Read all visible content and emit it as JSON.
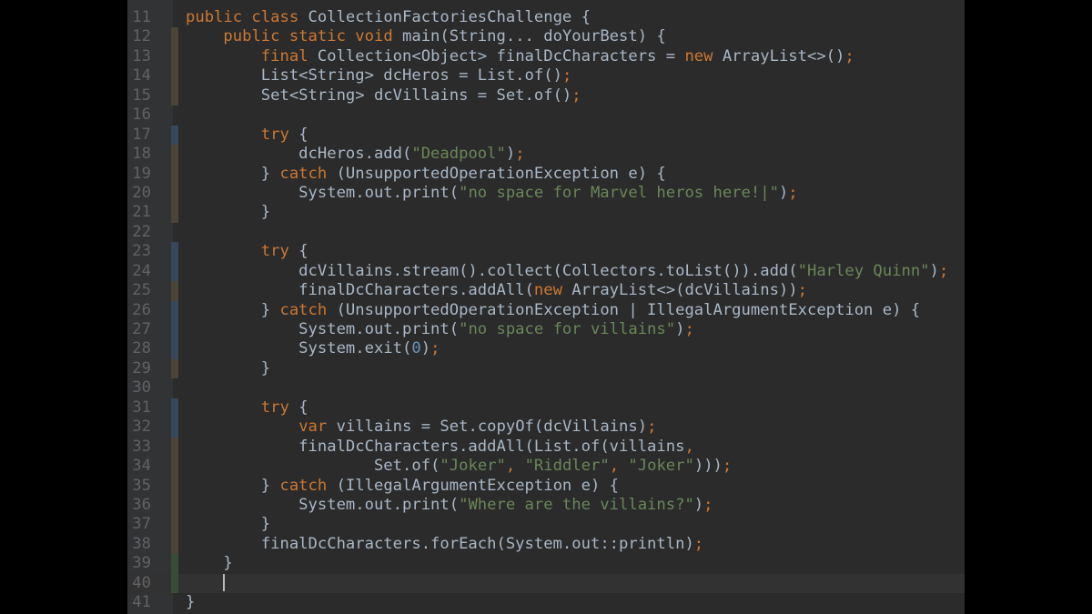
{
  "colors": {
    "background": "#2b2b2b",
    "gutter": "#313335",
    "keyword": "#cc7832",
    "string": "#6a8759",
    "number": "#6897bb",
    "text": "#a9b7c6",
    "line_number": "#606366"
  },
  "editor": {
    "current_line": 40,
    "lines": [
      {
        "n": "11",
        "mark": "",
        "tokens": [
          [
            "kw",
            "public class "
          ],
          [
            "t",
            "CollectionFactoriesChallenge {"
          ]
        ]
      },
      {
        "n": "12",
        "mark": "mod",
        "tokens": [
          [
            "t",
            "    "
          ],
          [
            "kw",
            "public static void "
          ],
          [
            "t",
            "main(String... doYourBest) {"
          ]
        ]
      },
      {
        "n": "13",
        "mark": "mod",
        "tokens": [
          [
            "t",
            "        "
          ],
          [
            "kw",
            "final "
          ],
          [
            "t",
            "Collection<Object> finalDcCharacters = "
          ],
          [
            "kw",
            "new "
          ],
          [
            "t",
            "ArrayList<>()"
          ],
          [
            "kw",
            ";"
          ]
        ]
      },
      {
        "n": "14",
        "mark": "mod",
        "tokens": [
          [
            "t",
            "        List<String> dcHeros = List."
          ],
          [
            "t",
            "of()"
          ],
          [
            "kw",
            ";"
          ]
        ]
      },
      {
        "n": "15",
        "mark": "mod",
        "tokens": [
          [
            "t",
            "        Set<String> dcVillains = Set."
          ],
          [
            "t",
            "of()"
          ],
          [
            "kw",
            ";"
          ]
        ]
      },
      {
        "n": "16",
        "mark": "",
        "tokens": []
      },
      {
        "n": "17",
        "mark": "blue",
        "tokens": [
          [
            "t",
            "        "
          ],
          [
            "kw",
            "try "
          ],
          [
            "t",
            "{"
          ]
        ]
      },
      {
        "n": "18",
        "mark": "mod",
        "tokens": [
          [
            "t",
            "            dcHeros.add("
          ],
          [
            "str",
            "\"Deadpool\""
          ],
          [
            "t",
            ")"
          ],
          [
            "kw",
            ";"
          ]
        ]
      },
      {
        "n": "19",
        "mark": "mod",
        "tokens": [
          [
            "t",
            "        } "
          ],
          [
            "kw",
            "catch "
          ],
          [
            "t",
            "(UnsupportedOperationException e) {"
          ]
        ]
      },
      {
        "n": "20",
        "mark": "mod",
        "tokens": [
          [
            "t",
            "            System."
          ],
          [
            "t",
            "out"
          ],
          [
            "t",
            ".print("
          ],
          [
            "str",
            "\"no space for Marvel heros here!|\""
          ],
          [
            "t",
            ")"
          ],
          [
            "kw",
            ";"
          ]
        ]
      },
      {
        "n": "21",
        "mark": "mod",
        "tokens": [
          [
            "t",
            "        }"
          ]
        ]
      },
      {
        "n": "22",
        "mark": "",
        "tokens": []
      },
      {
        "n": "23",
        "mark": "blue",
        "tokens": [
          [
            "t",
            "        "
          ],
          [
            "kw",
            "try "
          ],
          [
            "t",
            "{"
          ]
        ]
      },
      {
        "n": "24",
        "mark": "blue",
        "tokens": [
          [
            "t",
            "            dcVillains.stream().collect(Collectors."
          ],
          [
            "t",
            "toList"
          ],
          [
            "t",
            "()).add("
          ],
          [
            "str",
            "\"Harley Quinn\""
          ],
          [
            "t",
            ")"
          ],
          [
            "kw",
            ";"
          ]
        ]
      },
      {
        "n": "25",
        "mark": "mod",
        "tokens": [
          [
            "t",
            "            finalDcCharacters.addAll("
          ],
          [
            "kw",
            "new "
          ],
          [
            "t",
            "ArrayList<>(dcVillains))"
          ],
          [
            "kw",
            ";"
          ]
        ]
      },
      {
        "n": "26",
        "mark": "blue",
        "tokens": [
          [
            "t",
            "        } "
          ],
          [
            "kw",
            "catch "
          ],
          [
            "t",
            "(UnsupportedOperationException | IllegalArgumentException e) {"
          ]
        ]
      },
      {
        "n": "27",
        "mark": "blue",
        "tokens": [
          [
            "t",
            "            System."
          ],
          [
            "t",
            "out"
          ],
          [
            "t",
            ".print("
          ],
          [
            "str",
            "\"no space for villains\""
          ],
          [
            "t",
            ")"
          ],
          [
            "kw",
            ";"
          ]
        ]
      },
      {
        "n": "28",
        "mark": "blue",
        "tokens": [
          [
            "t",
            "            System."
          ],
          [
            "t",
            "exit"
          ],
          [
            "t",
            "("
          ],
          [
            "num",
            "0"
          ],
          [
            "t",
            ")"
          ],
          [
            "kw",
            ";"
          ]
        ]
      },
      {
        "n": "29",
        "mark": "mod",
        "tokens": [
          [
            "t",
            "        }"
          ]
        ]
      },
      {
        "n": "30",
        "mark": "",
        "tokens": []
      },
      {
        "n": "31",
        "mark": "blue",
        "tokens": [
          [
            "t",
            "        "
          ],
          [
            "kw",
            "try "
          ],
          [
            "t",
            "{"
          ]
        ]
      },
      {
        "n": "32",
        "mark": "blue",
        "tokens": [
          [
            "t",
            "            "
          ],
          [
            "kw",
            "var "
          ],
          [
            "t",
            "villains = Set."
          ],
          [
            "t",
            "copyOf"
          ],
          [
            "t",
            "(dcVillains)"
          ],
          [
            "kw",
            ";"
          ]
        ]
      },
      {
        "n": "33",
        "mark": "mod",
        "tokens": [
          [
            "t",
            "            finalDcCharacters.addAll(List."
          ],
          [
            "t",
            "of"
          ],
          [
            "t",
            "(villains"
          ],
          [
            "kw",
            ","
          ]
        ]
      },
      {
        "n": "34",
        "mark": "mod",
        "tokens": [
          [
            "t",
            "                    Set."
          ],
          [
            "t",
            "of"
          ],
          [
            "t",
            "("
          ],
          [
            "str",
            "\"Joker\""
          ],
          [
            "kw",
            ", "
          ],
          [
            "str",
            "\"Riddler\""
          ],
          [
            "kw",
            ", "
          ],
          [
            "str",
            "\"Joker\""
          ],
          [
            "t",
            ")))"
          ],
          [
            "kw",
            ";"
          ]
        ]
      },
      {
        "n": "35",
        "mark": "mod",
        "tokens": [
          [
            "t",
            "        } "
          ],
          [
            "kw",
            "catch "
          ],
          [
            "t",
            "(IllegalArgumentException e) {"
          ]
        ]
      },
      {
        "n": "36",
        "mark": "mod",
        "tokens": [
          [
            "t",
            "            System."
          ],
          [
            "t",
            "out"
          ],
          [
            "t",
            ".print("
          ],
          [
            "str",
            "\"Where are the villains?\""
          ],
          [
            "t",
            ")"
          ],
          [
            "kw",
            ";"
          ]
        ]
      },
      {
        "n": "37",
        "mark": "mod",
        "tokens": [
          [
            "t",
            "        }"
          ]
        ]
      },
      {
        "n": "38",
        "mark": "mod",
        "tokens": [
          [
            "t",
            "        finalDcCharacters.forEach(System."
          ],
          [
            "t",
            "out"
          ],
          [
            "t",
            "::println)"
          ],
          [
            "kw",
            ";"
          ]
        ]
      },
      {
        "n": "39",
        "mark": "add",
        "tokens": [
          [
            "t",
            "    }"
          ]
        ]
      },
      {
        "n": "40",
        "mark": "add",
        "tokens": [
          [
            "t",
            "    "
          ]
        ],
        "caret": true
      },
      {
        "n": "41",
        "mark": "",
        "tokens": [
          [
            "t",
            "}"
          ]
        ]
      }
    ]
  }
}
